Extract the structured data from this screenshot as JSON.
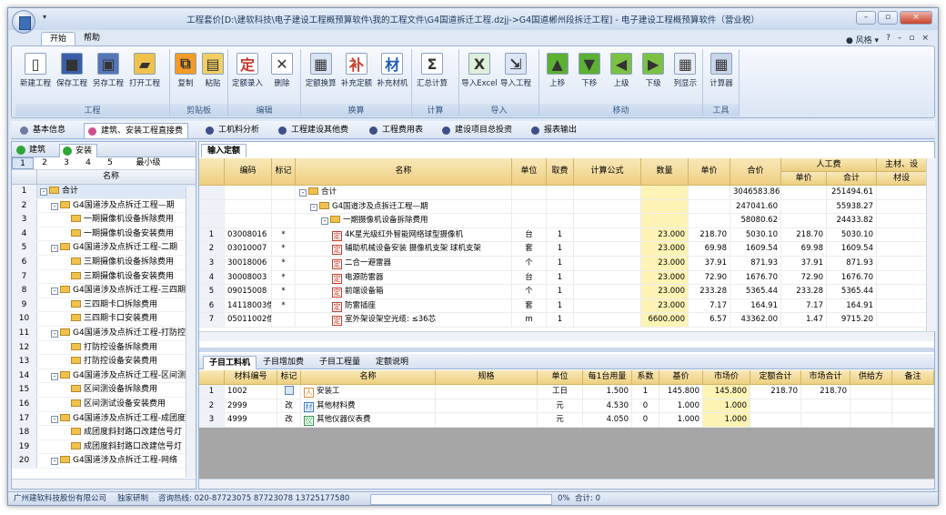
{
  "window": {
    "title": "工程套价[D:\\建软科技\\电子建设工程概预算软件\\我的工程文件\\G4国道拆迁工程.dzjj->G4国道郴州段拆迁工程] - 电子建设工程概预算软件（营业税）",
    "qat": "▾"
  },
  "ribbon_tabs": [
    "开始",
    "帮助"
  ],
  "top_right": {
    "style": "风格",
    "help": "?",
    "min": "–",
    "restore": "▫",
    "close": "×"
  },
  "ribbon": {
    "groups": [
      {
        "label": "工程",
        "buttons": [
          {
            "label": "新建工程",
            "icon": "new-file-icon",
            "glyph": "▯",
            "color": "#ffffff"
          },
          {
            "label": "保存工程",
            "icon": "save-icon",
            "glyph": "■",
            "color": "#3a5fa8"
          },
          {
            "label": "另存工程",
            "icon": "save-as-icon",
            "glyph": "▣",
            "color": "#5476b6"
          },
          {
            "label": "打开工程",
            "icon": "open-folder-icon",
            "glyph": "▰",
            "color": "#f0c24b"
          }
        ]
      },
      {
        "label": "剪贴板",
        "buttons": [
          {
            "label": "复制",
            "icon": "copy-icon",
            "glyph": "⧉",
            "color": "#f29b26"
          },
          {
            "label": "粘贴",
            "icon": "paste-icon",
            "glyph": "▤",
            "color": "#f3cf62"
          }
        ]
      },
      {
        "label": "编辑",
        "buttons": [
          {
            "label": "定额录入",
            "icon": "quota-entry-icon",
            "glyph": "定",
            "color": "#ffffff"
          },
          {
            "label": "删除",
            "icon": "delete-icon",
            "glyph": "✕",
            "color": "#ffffff"
          }
        ]
      },
      {
        "label": "换算",
        "buttons": [
          {
            "label": "定额换算",
            "icon": "quota-convert-icon",
            "glyph": "▦",
            "color": "#d9e4f3"
          },
          {
            "label": "补充定额",
            "icon": "supplement-quota-icon",
            "glyph": "补",
            "color": "#ffffff"
          },
          {
            "label": "补充材机",
            "icon": "supplement-material-icon",
            "glyph": "材",
            "color": "#ffffff"
          }
        ]
      },
      {
        "label": "计算",
        "buttons": [
          {
            "label": "汇总计算",
            "icon": "sum-icon",
            "glyph": "Σ",
            "color": "#ffffff"
          }
        ]
      },
      {
        "label": "导入",
        "buttons": [
          {
            "label": "导入Excel",
            "icon": "import-excel-icon",
            "glyph": "X",
            "color": "#dff0d9"
          },
          {
            "label": "导入工程",
            "icon": "import-project-icon",
            "glyph": "⇲",
            "color": "#dbe6f4"
          }
        ]
      },
      {
        "label": "移动",
        "buttons": [
          {
            "label": "上移",
            "icon": "arrow-up-icon",
            "glyph": "▲",
            "color": "#5cb132"
          },
          {
            "label": "下移",
            "icon": "arrow-down-icon",
            "glyph": "▼",
            "color": "#5cb132"
          },
          {
            "label": "上级",
            "icon": "arrow-left-icon",
            "glyph": "◀",
            "color": "#7bc143"
          },
          {
            "label": "下级",
            "icon": "arrow-right-icon",
            "glyph": "▶",
            "color": "#7bc143"
          },
          {
            "label": "列显示",
            "icon": "column-display-icon",
            "glyph": "▦",
            "color": "#e8eef8"
          }
        ]
      },
      {
        "label": "工具",
        "buttons": [
          {
            "label": "计算器",
            "icon": "calculator-icon",
            "glyph": "▦",
            "color": "#c8d6ea"
          }
        ]
      }
    ]
  },
  "section_tabs": [
    {
      "label": "基本信息",
      "icon": "info-icon",
      "color": "#6b7da0"
    },
    {
      "label": "建筑、安装工程直接费",
      "icon": "pink-circle-icon",
      "color": "#d04d8b"
    },
    {
      "label": "工机料分析",
      "icon": "analysis-icon",
      "color": "#3e4f8a"
    },
    {
      "label": "工程建设其他费",
      "icon": "other-fee-icon",
      "color": "#3e4f8a"
    },
    {
      "label": "工程费用表",
      "icon": "fee-table-icon",
      "color": "#3e4f8a"
    },
    {
      "label": "建设项目总投资",
      "icon": "total-investment-icon",
      "color": "#3e4f8a"
    },
    {
      "label": "报表输出",
      "icon": "report-icon",
      "color": "#3e4f8a"
    }
  ],
  "left_panel": {
    "tabs": [
      "建筑",
      "安装"
    ],
    "levels": [
      "1",
      "2",
      "3",
      "4",
      "5",
      "最小级"
    ],
    "header": "名称",
    "rows": [
      {
        "n": "1",
        "d": 0,
        "pm": "-",
        "t": "合计"
      },
      {
        "n": "2",
        "d": 1,
        "pm": "-",
        "t": "G4国道涉及点拆迁工程—期"
      },
      {
        "n": "3",
        "d": 2,
        "pm": "",
        "t": "一期摄像机设备拆除费用"
      },
      {
        "n": "4",
        "d": 2,
        "pm": "",
        "t": "一期摄像机设备安装费用"
      },
      {
        "n": "5",
        "d": 1,
        "pm": "-",
        "t": "G4国道涉及点拆迁工程-二期"
      },
      {
        "n": "6",
        "d": 2,
        "pm": "",
        "t": "三期摄像机设备拆除费用"
      },
      {
        "n": "7",
        "d": 2,
        "pm": "",
        "t": "三期摄像机设备安装费用"
      },
      {
        "n": "8",
        "d": 1,
        "pm": "-",
        "t": "G4国道涉及点拆迁工程-三四期"
      },
      {
        "n": "9",
        "d": 2,
        "pm": "",
        "t": "三四期卡口拆除费用"
      },
      {
        "n": "10",
        "d": 2,
        "pm": "",
        "t": "三四期卡口安装费用"
      },
      {
        "n": "11",
        "d": 1,
        "pm": "-",
        "t": "G4国道涉及点拆迁工程-打防控"
      },
      {
        "n": "12",
        "d": 2,
        "pm": "",
        "t": "打防控设备拆除费用"
      },
      {
        "n": "13",
        "d": 2,
        "pm": "",
        "t": "打防控设备安装费用"
      },
      {
        "n": "14",
        "d": 1,
        "pm": "-",
        "t": "G4国道涉及点拆迁工程-区间测"
      },
      {
        "n": "15",
        "d": 2,
        "pm": "",
        "t": "区间测设备拆除费用"
      },
      {
        "n": "16",
        "d": 2,
        "pm": "",
        "t": "区间测试设备安装费用"
      },
      {
        "n": "17",
        "d": 1,
        "pm": "-",
        "t": "G4国道涉及点拆迁工程-成团度"
      },
      {
        "n": "18",
        "d": 2,
        "pm": "",
        "t": "成团度斜封路口改建信号灯"
      },
      {
        "n": "19",
        "d": 2,
        "pm": "",
        "t": "成团度斜封路口改建信号灯"
      },
      {
        "n": "20",
        "d": 1,
        "pm": "-",
        "t": "G4国道涉及点拆迁工程-网络"
      }
    ]
  },
  "main": {
    "tab": "输入定额",
    "headers": {
      "code": "编码",
      "mark": "标记",
      "name": "名称",
      "unit": "单位",
      "fee": "取费",
      "formula": "计算公式",
      "qty": "数量",
      "price": "单价",
      "total": "合价",
      "labor": "人工费",
      "labor_unit": "单价",
      "labor_total": "合计",
      "main_mat": "主材、设",
      "main_mat_sub": "材设"
    },
    "rows": [
      {
        "n": "",
        "code": "",
        "mark": "",
        "name": "合计",
        "type": "folder",
        "d": 0,
        "unit": "",
        "fee": "",
        "formula": "",
        "qty": "",
        "price": "",
        "total": "3046583.86",
        "lu": "",
        "lt": "251494.61"
      },
      {
        "n": "",
        "code": "",
        "mark": "",
        "name": "G4国道涉及点拆迁工程—期",
        "type": "folder",
        "d": 1,
        "unit": "",
        "fee": "",
        "formula": "",
        "qty": "",
        "price": "",
        "total": "247041.60",
        "lu": "",
        "lt": "55938.27"
      },
      {
        "n": "",
        "code": "",
        "mark": "",
        "name": "一期摄像机设备拆除费用",
        "type": "folder",
        "d": 2,
        "unit": "",
        "fee": "",
        "formula": "",
        "qty": "",
        "price": "",
        "total": "58080.62",
        "lu": "",
        "lt": "24433.82"
      },
      {
        "n": "1",
        "code": "03008016",
        "mark": "*",
        "name": "4K星光级红外智能网络球型摄像机",
        "type": "ding",
        "d": 3,
        "unit": "台",
        "fee": "1",
        "formula": "",
        "qty": "23.000",
        "price": "218.70",
        "total": "5030.10",
        "lu": "218.70",
        "lt": "5030.10"
      },
      {
        "n": "2",
        "code": "03010007",
        "mark": "*",
        "name": "辅助机械设备安装 摄像机支架 球机支架",
        "type": "ding",
        "d": 3,
        "unit": "套",
        "fee": "1",
        "formula": "",
        "qty": "23.000",
        "price": "69.98",
        "total": "1609.54",
        "lu": "69.98",
        "lt": "1609.54"
      },
      {
        "n": "3",
        "code": "30018006",
        "mark": "*",
        "name": "二合一避雷器",
        "type": "ding",
        "d": 3,
        "unit": "个",
        "fee": "1",
        "formula": "",
        "qty": "23.000",
        "price": "37.91",
        "total": "871.93",
        "lu": "37.91",
        "lt": "871.93"
      },
      {
        "n": "4",
        "code": "30008003",
        "mark": "*",
        "name": "电源防雷器",
        "type": "ding",
        "d": 3,
        "unit": "台",
        "fee": "1",
        "formula": "",
        "qty": "23.000",
        "price": "72.90",
        "total": "1676.70",
        "lu": "72.90",
        "lt": "1676.70"
      },
      {
        "n": "5",
        "code": "09015008",
        "mark": "*",
        "name": "前端设备箱",
        "type": "ding",
        "d": 3,
        "unit": "个",
        "fee": "1",
        "formula": "",
        "qty": "23.000",
        "price": "233.28",
        "total": "5365.44",
        "lu": "233.28",
        "lt": "5365.44"
      },
      {
        "n": "6",
        "code": "14118003借",
        "mark": "*",
        "name": "防雷插座",
        "type": "ding",
        "d": 3,
        "unit": "套",
        "fee": "1",
        "formula": "",
        "qty": "23.000",
        "price": "7.17",
        "total": "164.91",
        "lu": "7.17",
        "lt": "164.91"
      },
      {
        "n": "7",
        "code": "05011002借",
        "mark": "",
        "name": "室外架设架空光缆: ≤36芯",
        "type": "ding",
        "d": 3,
        "unit": "m",
        "fee": "1",
        "formula": "",
        "qty": "6600.000",
        "price": "6.57",
        "total": "43362.00",
        "lu": "1.47",
        "lt": "9715.20"
      }
    ]
  },
  "bottom": {
    "tabs": [
      "子目工料机",
      "子目增加费",
      "子目工程量",
      "定额说明"
    ],
    "headers": [
      "材料编号",
      "标记",
      "名称",
      "规格",
      "单位",
      "每1台用量",
      "系数",
      "基价",
      "市场价",
      "定额合计",
      "市场合计",
      "供给方",
      "备注"
    ],
    "rows": [
      {
        "n": "1",
        "code": "1002",
        "mark": "",
        "badge": "人",
        "name": "安装工",
        "spec": "",
        "unit": "工日",
        "usage": "1.500",
        "coef": "1",
        "base": "145.800",
        "market": "145.800",
        "qt": "218.70",
        "mt": "218.70"
      },
      {
        "n": "2",
        "code": "2999",
        "mark": "改",
        "badge": "材",
        "name": "其他材料费",
        "spec": "",
        "unit": "元",
        "usage": "4.530",
        "coef": "0",
        "base": "1.000",
        "market": "1.000",
        "qt": "",
        "mt": ""
      },
      {
        "n": "3",
        "code": "4999",
        "mark": "改",
        "badge": "仪",
        "name": "其他仪器仪表费",
        "spec": "",
        "unit": "元",
        "usage": "4.050",
        "coef": "0",
        "base": "1.000",
        "market": "1.000",
        "qt": "",
        "mt": ""
      }
    ]
  },
  "status": {
    "company": "广州建软科技股份有限公司",
    "dev": "独家研制",
    "hotline": "咨询热线: 020-87723075  87723078  13725177580",
    "progress": "0%",
    "total": "合计: 0"
  }
}
